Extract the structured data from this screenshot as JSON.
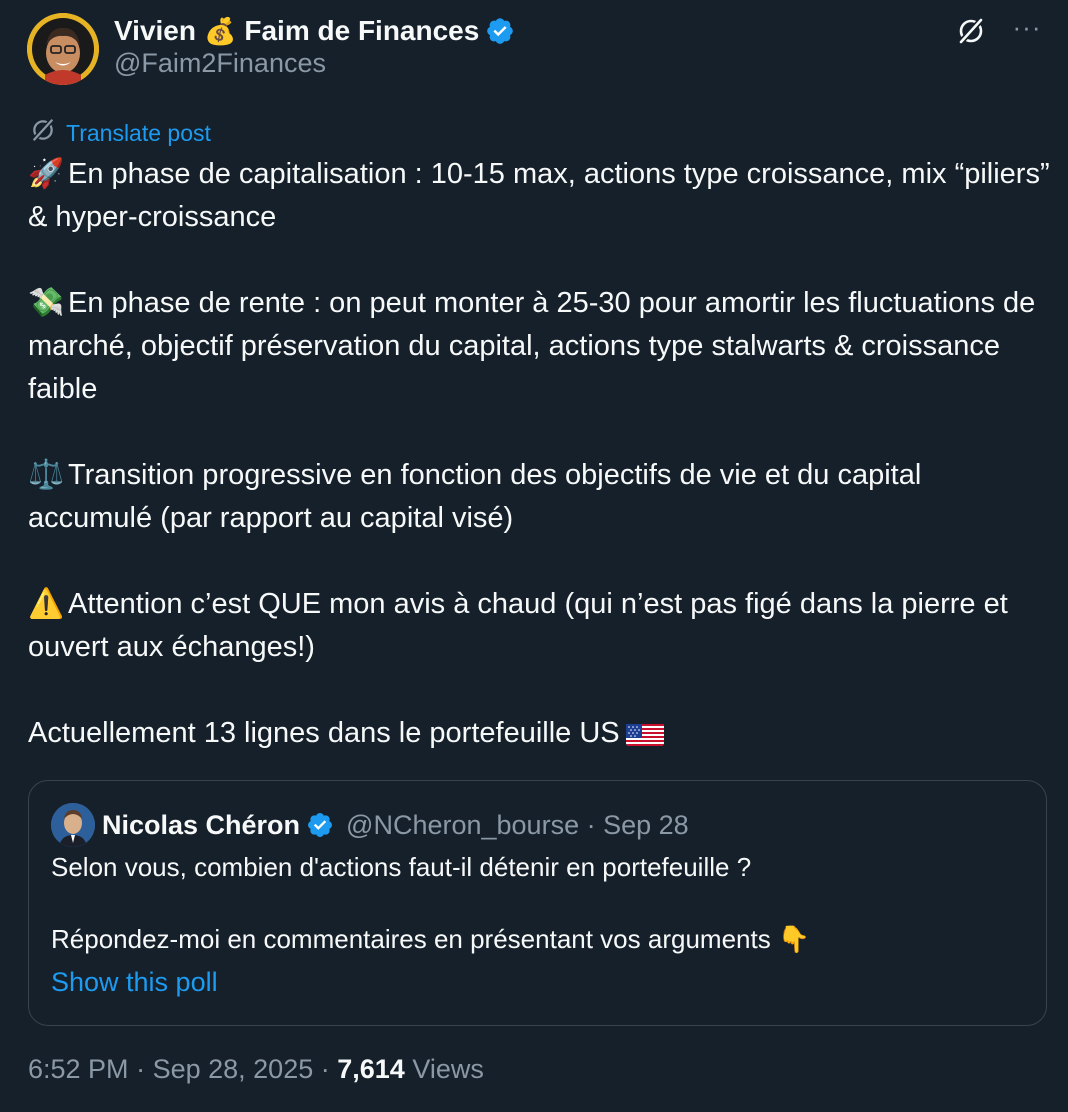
{
  "author": {
    "display_name_part1": "Vivien",
    "display_name_emoji": "💰",
    "display_name_part2": "Faim de Finances",
    "handle": "@Faim2Finances",
    "verified": true
  },
  "translate_label": "Translate post",
  "body": {
    "paragraphs": [
      {
        "emoji": "🚀",
        "text": "En phase de capitalisation : 10-15 max, actions type croissance, mix “piliers” & hyper-croissance"
      },
      {
        "emoji": "💸",
        "text": "En phase de rente : on peut monter à 25-30 pour amortir les fluctuations de marché, objectif préservation du capital, actions type stalwarts & croissance faible"
      },
      {
        "emoji": "⚖️",
        "text": "Transition progressive en fonction des objectifs de vie et du capital accumulé (par rapport au capital visé)"
      },
      {
        "emoji": "⚠️",
        "text": "Attention c’est QUE mon avis à chaud (qui n’est pas figé dans la pierre et ouvert aux échanges!)"
      },
      {
        "emoji": "",
        "text": "Actuellement 13 lignes dans le portefeuille US"
      }
    ],
    "flag_icon": "us-flag-icon"
  },
  "quote": {
    "name": "Nicolas Chéron",
    "verified": true,
    "meta": "@NCheron_bourse · Sep 28",
    "lines": [
      "Selon vous, combien d'actions faut-il détenir en portefeuille ?",
      "Répondez-moi en commentaires en présentant vos arguments 👇"
    ],
    "show_poll_label": "Show this poll"
  },
  "footer": {
    "time": "6:52 PM",
    "date": "Sep 28, 2025",
    "views_count": "7,614",
    "views_label": "Views"
  },
  "colors": {
    "background": "#15202b",
    "accent": "#1d9bf0",
    "secondary_text": "#8b98a5",
    "primary_text": "#f7f9f9",
    "border": "#38444d"
  }
}
